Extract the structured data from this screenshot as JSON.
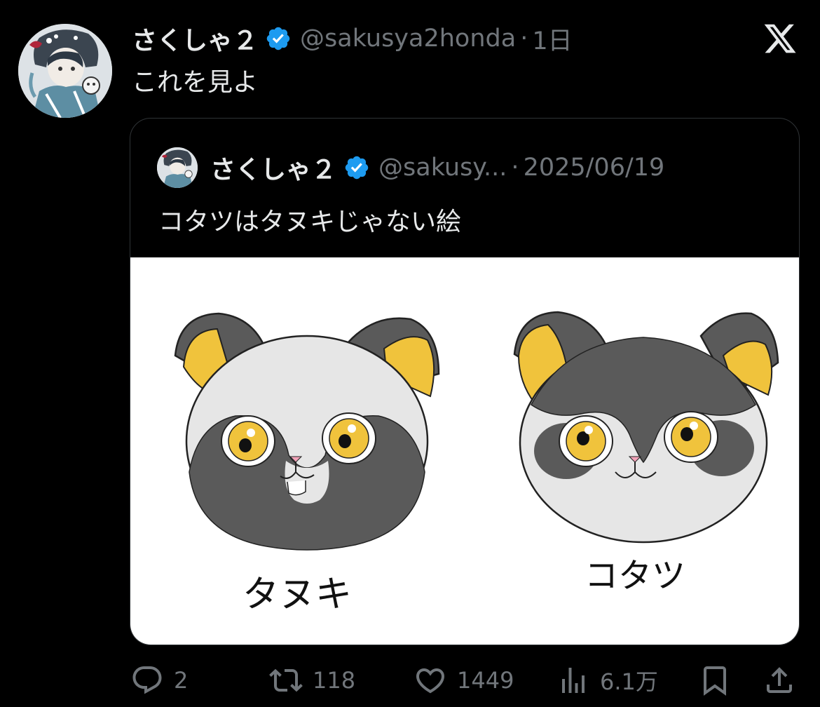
{
  "tweet": {
    "display_name": "さくしゃ２",
    "handle": "@sakusya2honda",
    "separator": "·",
    "time": "1日",
    "text": "これを見よ",
    "verified_color": "#1d9bf0"
  },
  "quoted_tweet": {
    "display_name": "さくしゃ２",
    "handle": "@sakusy...",
    "separator": "·",
    "date": "2025/06/19",
    "text": "コタツはタヌキじゃない絵",
    "image": {
      "left_label": "タヌキ",
      "right_label": "コタツ",
      "ear_color": "#f0c33c",
      "fur_dark": "#5a5a5a",
      "fur_light": "#e6e6e6"
    }
  },
  "actions": {
    "reply_count": "2",
    "retweet_count": "118",
    "like_count": "1449",
    "views_count": "6.1万"
  },
  "icons": {
    "logo": "x-logo-icon",
    "verified": "verified-badge-icon",
    "reply": "reply-icon",
    "retweet": "retweet-icon",
    "like": "heart-icon",
    "views": "views-icon",
    "bookmark": "bookmark-icon",
    "share": "share-icon"
  }
}
